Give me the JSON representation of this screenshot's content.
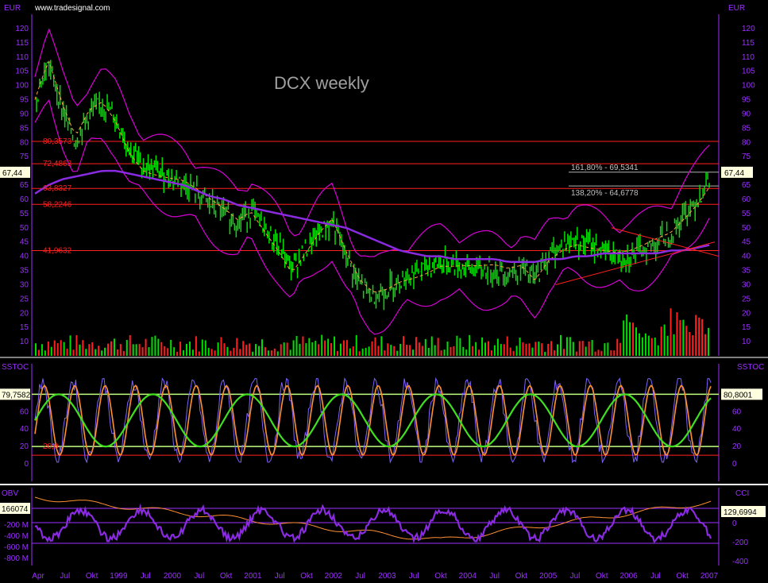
{
  "header": {
    "site": "www.tradesignal.com",
    "currency_left": "EUR",
    "currency_right": "EUR"
  },
  "colors": {
    "background": "#000000",
    "axis": "#9b30ff",
    "price_up": "#00e000",
    "price_down": "#ff2020",
    "bollinger": "#d800d8",
    "ma_long": "#8a2be2",
    "ma_mid": "#ffa040",
    "fib": "#ff2020",
    "stoch_k": "#8060ff",
    "stoch_d": "#ff9030",
    "stoch_signal": "#40e020",
    "obv": "#8a2be2",
    "cci": "#ff9030"
  },
  "chart_data": [
    {
      "type": "line",
      "title": "DCX weekly",
      "panel": "price",
      "ylim": [
        5,
        125
      ],
      "yticks": [
        10,
        15,
        20,
        25,
        30,
        35,
        40,
        45,
        50,
        55,
        60,
        65,
        70,
        75,
        80,
        85,
        90,
        95,
        100,
        105,
        110,
        115,
        120
      ],
      "last_price": "67,44",
      "fib_levels": [
        {
          "label": "80,3573",
          "value": 80.36
        },
        {
          "label": "72,4863",
          "value": 72.49
        },
        {
          "label": "63,8327",
          "value": 63.83
        },
        {
          "label": "58,2246",
          "value": 58.22
        },
        {
          "label": "41,9632",
          "value": 41.96
        }
      ],
      "target_levels": [
        {
          "label": "161,80% - 69,5341",
          "value": 69.53
        },
        {
          "label": "138,20% - 64,6778",
          "value": 64.68
        }
      ],
      "x_labels": [
        "Apr",
        "Jul",
        "Okt",
        "1999",
        "Jul",
        "2000",
        "Jul",
        "Okt",
        "2001",
        "Jul",
        "Okt",
        "2002",
        "Jul",
        "2003",
        "Jul",
        "Okt",
        "2004",
        "Jul",
        "Okt",
        "2005",
        "Jul",
        "Okt",
        "2006",
        "Jul",
        "Okt",
        "2007"
      ],
      "series": [
        {
          "name": "",
          "values": [
            95,
            108,
            92,
            80,
            90,
            94,
            88,
            78,
            72,
            70,
            68,
            66,
            62,
            58,
            55,
            52,
            56,
            50,
            44,
            36,
            42,
            48,
            52,
            40,
            30,
            26,
            28,
            32,
            34,
            36,
            38,
            37,
            36,
            35,
            35,
            34,
            36,
            32,
            40,
            44,
            46,
            44,
            42,
            40,
            40,
            42,
            45,
            48,
            54,
            60,
            67
          ]
        },
        {
          "name": "",
          "values": [
            62,
            65,
            67,
            68,
            69,
            70,
            70,
            69,
            68,
            67,
            66,
            65,
            63,
            61,
            60,
            58,
            57,
            56,
            55,
            54,
            53,
            52,
            51,
            50,
            48,
            46,
            44,
            42,
            41,
            40,
            40,
            39,
            39,
            39,
            39,
            38,
            38,
            38,
            39,
            39,
            40,
            40,
            41,
            41,
            41,
            41,
            41,
            42,
            42,
            43,
            44
          ]
        }
      ]
    },
    {
      "type": "line",
      "panel": "stochastic",
      "label_left": "SSTOC",
      "label_right": "SSTOC",
      "ylim": [
        -20,
        115
      ],
      "yticks": [
        0,
        20,
        40,
        60,
        80
      ],
      "overbought": 80,
      "oversold": 20,
      "current_left": "79,7582",
      "current_right": "80,8001",
      "oversold_label": "20,0"
    },
    {
      "type": "line",
      "panel": "obv_cci",
      "label_left": "OBV",
      "label_right": "CCI",
      "obv_ticks": [
        "-200 M",
        "-400 M",
        "-600 M",
        "-800 M"
      ],
      "cci_ticks": [
        0,
        -200,
        -400
      ],
      "obv_current": "166074",
      "cci_current": "129,6994"
    }
  ]
}
